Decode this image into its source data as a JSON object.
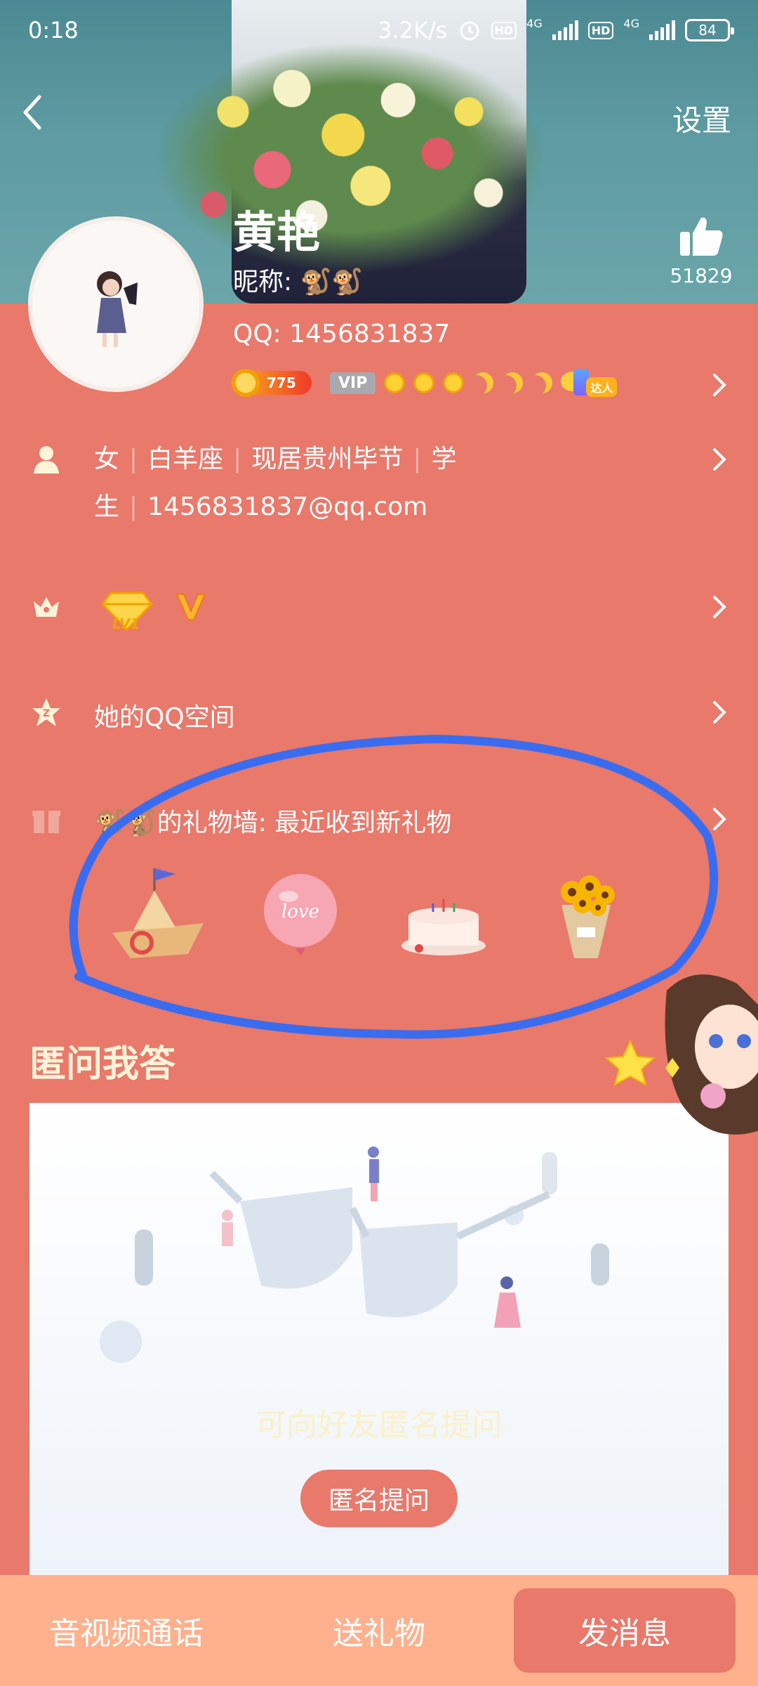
{
  "status_bar": {
    "time": "0:18",
    "speed": "3.2K/s",
    "network1": "4G",
    "network2": "4G",
    "hd1": "HD",
    "hd2": "HD",
    "battery": "84"
  },
  "header": {
    "settings_label": "设置"
  },
  "profile": {
    "name": "黄艳",
    "nickname": "昵称: 🐒🐒",
    "like_count": "51829",
    "qq": "QQ: 1456831837",
    "level_badge": "775",
    "vip_badge": "VIP",
    "daren_badge": "达人"
  },
  "info": {
    "gender": "女",
    "zodiac": "白羊座",
    "location": "现居贵州毕节",
    "occupation": "学生",
    "email": "1456831837@qq.com"
  },
  "vip_row": {
    "diamond_label": "LV1"
  },
  "qzone_row": {
    "label": "她的QQ空间"
  },
  "gift_row": {
    "label": "🐒🐒的礼物墙: 最近收到新礼物",
    "gifts": [
      "paper-boat",
      "love-balloon",
      "birthday-cake",
      "sunflower-bouquet"
    ],
    "balloon_text": "love"
  },
  "qa": {
    "title": "匿问我答",
    "hint": "可向好友匿名提问",
    "button": "匿名提问"
  },
  "bottom_bar": {
    "call": "音视频通话",
    "gift": "送礼物",
    "message": "发消息"
  },
  "colors": {
    "background": "#e8796b",
    "bottom_bar": "#ffb08c",
    "annotation": "#3a6cf0"
  }
}
